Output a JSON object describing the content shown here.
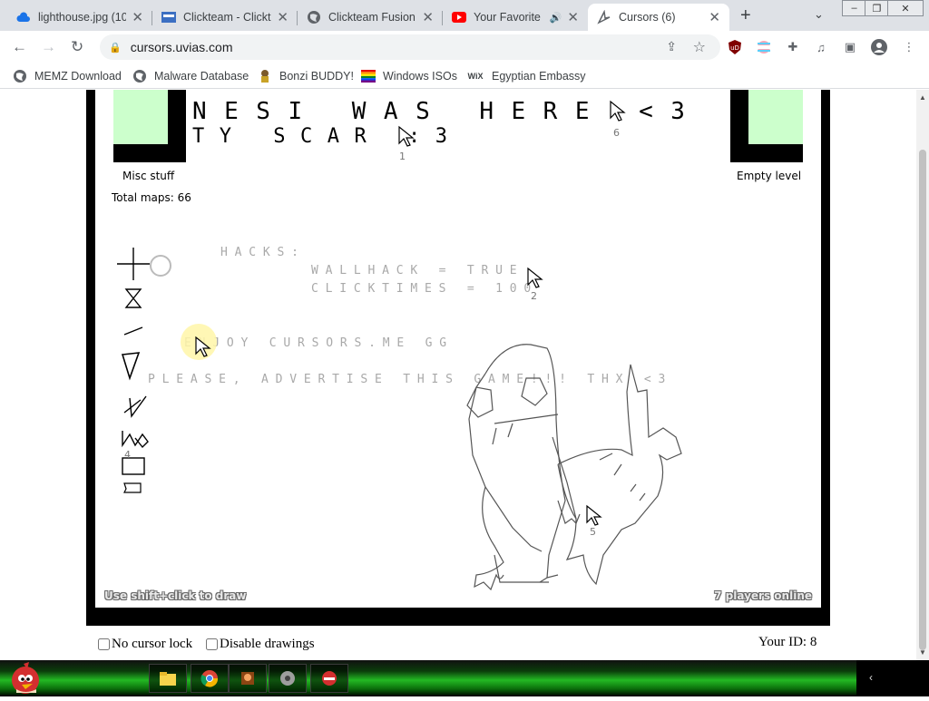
{
  "tabs": [
    {
      "title": "lighthouse.jpg (10",
      "icon": "cloud-icon"
    },
    {
      "title": "Clickteam - Clickt",
      "icon": "clickteam-icon"
    },
    {
      "title": "Clickteam Fusion",
      "icon": "globe-icon"
    },
    {
      "title": "Your Favorite",
      "icon": "youtube-icon"
    },
    {
      "title": "Cursors (6)",
      "icon": "cursors-icon"
    }
  ],
  "toolbar": {
    "url": "cursors.uvias.com"
  },
  "bookmarks": [
    {
      "label": "MEMZ Download",
      "icon": "globe-icon"
    },
    {
      "label": "Malware Database",
      "icon": "globe-icon"
    },
    {
      "label": "Bonzi BUDDY!",
      "icon": "bonzi-icon"
    },
    {
      "label": "Windows ISOs",
      "icon": "windows-flag-icon"
    },
    {
      "label": "Egyptian Embassy",
      "icon": "wix-icon"
    }
  ],
  "game": {
    "headline1": "NESI WAS HERE <3",
    "headline2": "TY SCAR :3",
    "misc_label": "Misc stuff",
    "empty_label": "Empty level",
    "total_maps": "Total maps: 66",
    "hacks_title": "HACKS:",
    "hack1": "WALLHACK = TRUE",
    "hack2": "CLICKTIMES = 100",
    "enjoy": "ENJOY CURSORS.ME GG",
    "advertise": "PLEASE, ADVERTISE THIS GAME!!! THX <3",
    "footer_left": "Use shift+click to draw",
    "footer_right": "7 players online",
    "cursor_ids": [
      "1",
      "2",
      "4",
      "5",
      "6"
    ]
  },
  "options": {
    "no_cursor_lock": "No cursor lock",
    "disable_drawings": "Disable drawings",
    "your_id": "Your ID: 8"
  },
  "colors": {
    "tab_strip": "#dee1e6",
    "green_box": "#ccffcc",
    "game_text": "#000000",
    "faded_text": "#a9a9a9",
    "highlight": "#fff6a8"
  }
}
